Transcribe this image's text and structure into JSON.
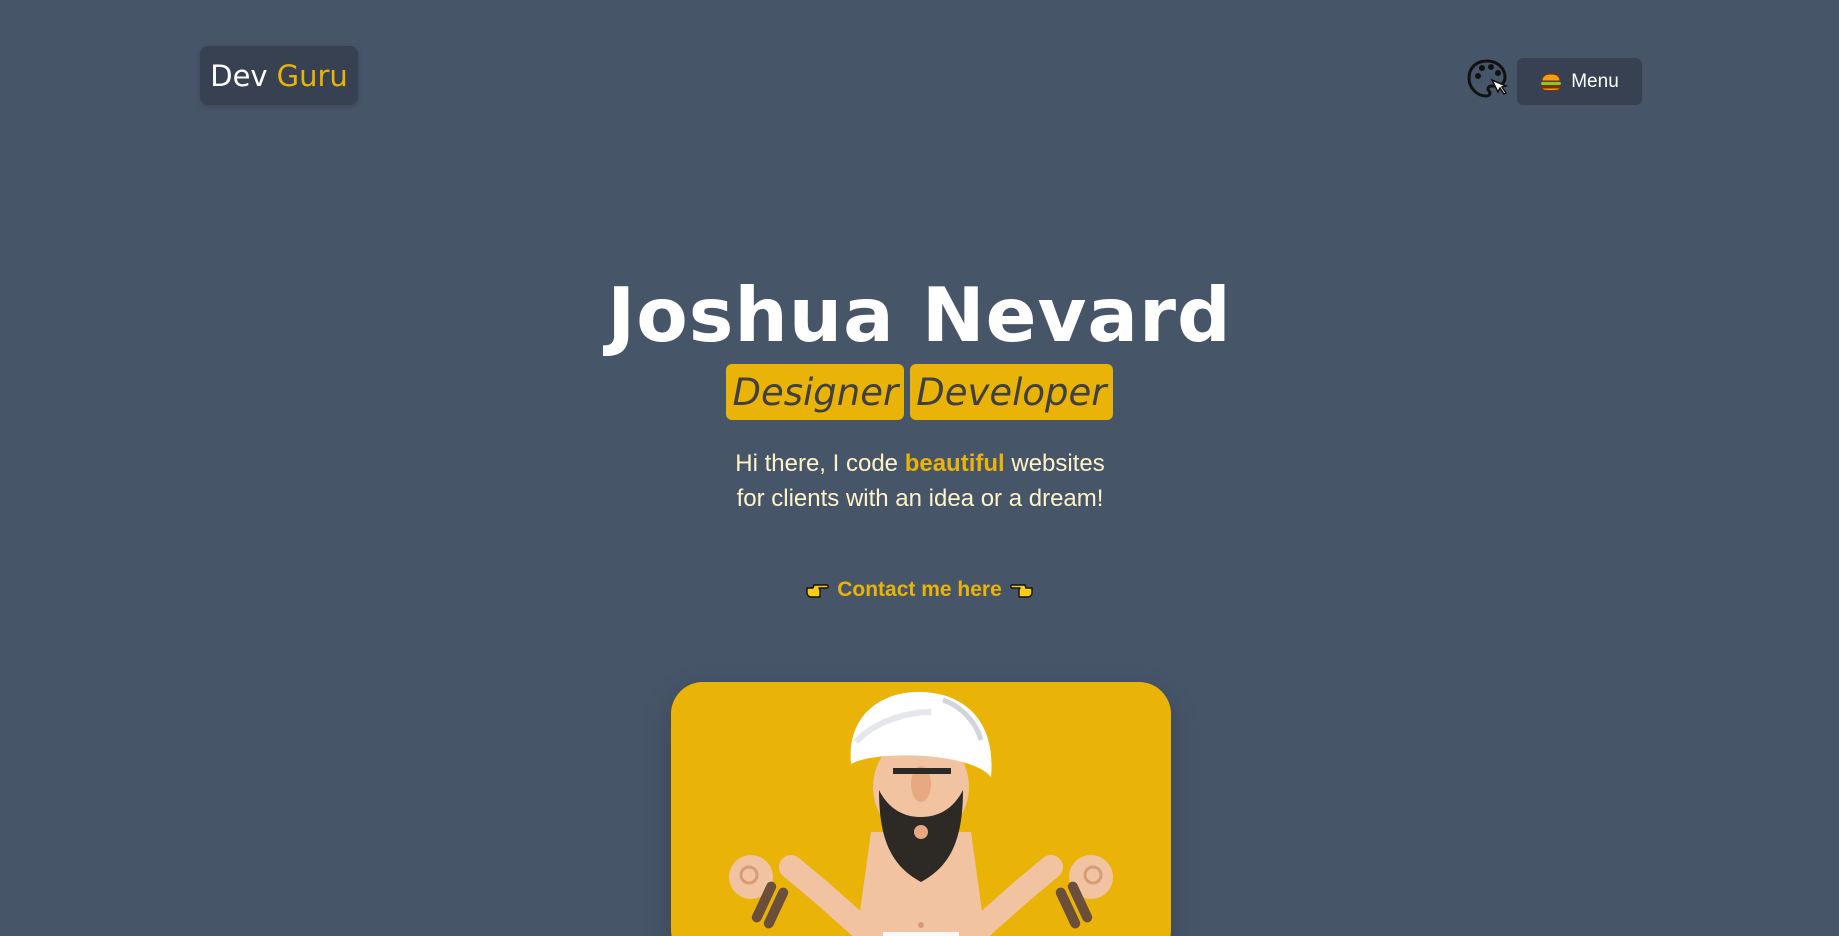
{
  "header": {
    "logo_primary": "Dev",
    "logo_accent": "Guru",
    "menu_label": "Menu",
    "theme_icon": "palette-icon",
    "menu_icon": "burger-icon"
  },
  "hero": {
    "name": "Joshua Nevard",
    "roles": [
      "Designer",
      "Developer"
    ],
    "intro_before": "Hi there, I code ",
    "intro_highlight": "beautiful",
    "intro_after": " websites for clients with an idea or a dream!",
    "contact_label": "Contact me here",
    "contact_left_icon": "hand-pointing-right-icon",
    "contact_right_icon": "hand-pointing-left-icon"
  },
  "illustration": {
    "subject": "meditating-guru-illustration"
  },
  "colors": {
    "background": "#475569",
    "accent": "#eab308",
    "panel": "#374151",
    "intro_text": "#fef3c7"
  }
}
